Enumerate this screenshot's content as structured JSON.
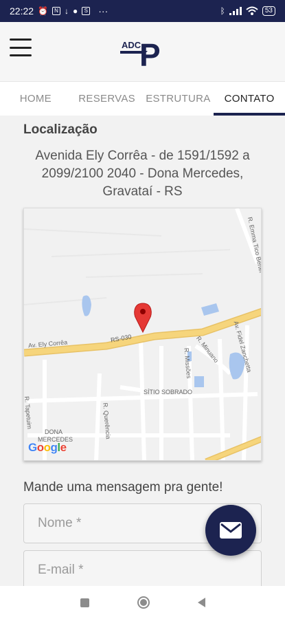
{
  "status_bar": {
    "time": "22:22",
    "battery": "53",
    "more": "···"
  },
  "header": {
    "logo_text": "ADC",
    "logo_letter": "P"
  },
  "tabs": [
    {
      "label": "HOME",
      "active": false
    },
    {
      "label": "RESERVAS",
      "active": false
    },
    {
      "label": "ESTRUTURA",
      "active": false
    },
    {
      "label": "CONTATO",
      "active": true
    }
  ],
  "location": {
    "title": "Localização",
    "address": "Avenida Ely Corrêa - de 1591/1592 a 2099/2100 2040 - Dona Mercedes, Gravataí - RS"
  },
  "map": {
    "labels": {
      "r_emma": "R. Emma Tico Bertei",
      "av_ely": "Av. Ely Corrêa",
      "rs030": "RS-030",
      "av_fidel": "Av. Fidel Zanchetta",
      "r_minuano": "R. Minuano",
      "r_missoes": "R. Missões",
      "sitio": "SÍTIO SOBRADO",
      "r_querencia": "R. Querência",
      "r_tapetuim": "R. Tapetuim",
      "dona": "DONA",
      "mercedes": "MERCEDES",
      "google": "Google"
    }
  },
  "contact_form": {
    "title": "Mande uma mensagem pra gente!",
    "name_placeholder": "Nome *",
    "email_placeholder": "E-mail *"
  },
  "colors": {
    "brand_navy": "#1c2350",
    "road_yellow": "#f6d57c",
    "water_blue": "#a9c6ee",
    "pin_red": "#e53935"
  },
  "icons": {
    "fab": "mail-icon",
    "menu": "hamburger-menu-icon",
    "pin": "map-pin-icon"
  }
}
